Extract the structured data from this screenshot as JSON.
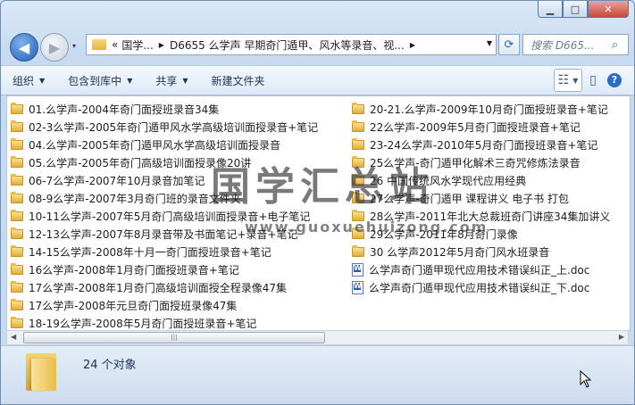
{
  "window": {
    "min_label": "▁",
    "max_label": "□",
    "close_label": "✕"
  },
  "nav": {
    "back_glyph": "◀",
    "forward_glyph": "▶",
    "history_glyph": "▾"
  },
  "address": {
    "prefix": "«",
    "segments": [
      "国学...",
      "D6655 么学声 早期奇门遁甲、风水等录音、视..."
    ],
    "refresh_glyph": "⟳"
  },
  "search": {
    "placeholder": "搜索 D665...",
    "glyph": "⌕"
  },
  "toolbar": {
    "organize": "组织",
    "include_in_library": "包含到库中",
    "share": "共享",
    "new_folder": "新建文件夹"
  },
  "files_col1": [
    {
      "name": "01.么学声-2004年奇门面授班录音34集",
      "type": "folder"
    },
    {
      "name": "02-3么学声-2005年奇门遁甲风水学高级培训面授录音+笔记",
      "type": "folder"
    },
    {
      "name": "04.么学声-2005年奇门遁甲风水学高级培训面授录音",
      "type": "folder"
    },
    {
      "name": "05.么学声-2005年奇门高级培训面授录像20讲",
      "type": "folder"
    },
    {
      "name": "06-7么学声-2007年10月录音加笔记",
      "type": "folder"
    },
    {
      "name": "08-9么学声-2007年3月奇门班的录音文件夹",
      "type": "folder"
    },
    {
      "name": "10-11么学声-2007年5月奇门高级培训面授录音+电子笔记",
      "type": "folder"
    },
    {
      "name": "12-13么学声-2007年8月录音带及书面笔记+录音+笔记",
      "type": "folder"
    },
    {
      "name": "14-15么学声-2008年十月一奇门面授班录音+笔记",
      "type": "folder"
    },
    {
      "name": "16么学声-2008年1月奇门面授班录音+笔记",
      "type": "folder"
    },
    {
      "name": "17么学声-2008年1月奇门高级培训面授全程录像47集",
      "type": "folder"
    },
    {
      "name": "17么学声-2008年元旦奇门面授班录像47集",
      "type": "folder"
    },
    {
      "name": "18-19么学声-2008年5月奇门面授班录音+笔记",
      "type": "folder"
    }
  ],
  "files_col2": [
    {
      "name": "20-21.么学声-2009年10月奇门面授班录音+笔记",
      "type": "folder"
    },
    {
      "name": "22么学声-2009年5月奇门面授班录音+笔记",
      "type": "folder"
    },
    {
      "name": "23-24么学声-2010年5月奇门面授班录音+笔记",
      "type": "folder"
    },
    {
      "name": "25么学声-奇门遁甲化解术三奇咒修炼法录音",
      "type": "folder"
    },
    {
      "name": "26 中国传统风水学现代应用经典",
      "type": "folder"
    },
    {
      "name": "27么学声-奇门遁甲 课程讲义 电子书 打包",
      "type": "folder"
    },
    {
      "name": "28么学声-2011年北大总裁班奇门讲座34集加讲义",
      "type": "folder"
    },
    {
      "name": "29么学声-2011年8月奇门录像",
      "type": "folder"
    },
    {
      "name": "30 么学声2012年5月奇门风水班录音",
      "type": "folder"
    },
    {
      "name": "么学声奇门遁甲现代应用技术错误纠正_上.doc",
      "type": "doc"
    },
    {
      "name": "么学声奇门遁甲现代应用技术错误纠正_下.doc",
      "type": "doc"
    }
  ],
  "scrollbar": {
    "left_arrow": "◀",
    "right_arrow": "▶",
    "grip": "|||"
  },
  "status": {
    "item_count": "24 个对象"
  },
  "watermark": {
    "title": "国学汇总站",
    "url": "www.guoxuehuizong.com"
  }
}
